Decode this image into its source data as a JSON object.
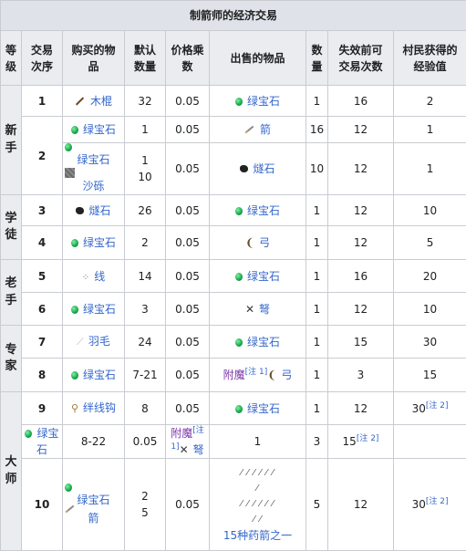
{
  "table": {
    "caption": "制箭师的经济交易",
    "headers": [
      "等级",
      "交易次序",
      "购买的物品",
      "默认数量",
      "价格乘数",
      "出售的物品",
      "数量",
      "失效前可交易次数",
      "村民获得的经验值"
    ],
    "header_lines": {
      "tier": [
        "等",
        "级"
      ],
      "order": [
        "交易",
        "次序"
      ],
      "buy": [
        "购买的物",
        "品"
      ],
      "default_qty": [
        "默认",
        "数量"
      ],
      "price_mult": [
        "价格乘",
        "数"
      ],
      "sell": "出售的物品",
      "qty": [
        "数",
        "量"
      ],
      "uses": [
        "失效前可",
        "交易次数"
      ],
      "xp": [
        "村民获得的",
        "经验值"
      ]
    },
    "tiers": {
      "novice": [
        "新",
        "手"
      ],
      "apprentice": [
        "学",
        "徒"
      ],
      "journeyman": [
        "老",
        "手"
      ],
      "expert": [
        "专",
        "家"
      ],
      "master": [
        "大",
        "师"
      ]
    },
    "note_label": "[注 1]",
    "note_label_2": "[注 2]",
    "rows": {
      "r1": {
        "order": "1",
        "buy": "木棍",
        "default_qty": "32",
        "price_mult": "0.05",
        "sell": "绿宝石",
        "qty": "1",
        "uses": "16",
        "xp": "2"
      },
      "r2a": {
        "order": "2",
        "buy": "绿宝石",
        "default_qty": "1",
        "price_mult": "0.05",
        "sell": "箭",
        "qty": "16",
        "uses": "12",
        "xp": "1"
      },
      "r2b": {
        "buy1": "绿宝石",
        "buy2": "沙砾",
        "default_qty1": "1",
        "default_qty2": "10",
        "price_mult": "0.05",
        "sell": "燧石",
        "qty": "10",
        "uses": "12",
        "xp": "1"
      },
      "r3": {
        "order": "3",
        "buy": "燧石",
        "default_qty": "26",
        "price_mult": "0.05",
        "sell": "绿宝石",
        "qty": "1",
        "uses": "12",
        "xp": "10"
      },
      "r4": {
        "order": "4",
        "buy": "绿宝石",
        "default_qty": "2",
        "price_mult": "0.05",
        "sell": "弓",
        "qty": "1",
        "uses": "12",
        "xp": "5"
      },
      "r5": {
        "order": "5",
        "buy": "线",
        "default_qty": "14",
        "price_mult": "0.05",
        "sell": "绿宝石",
        "qty": "1",
        "uses": "16",
        "xp": "20"
      },
      "r6": {
        "order": "6",
        "buy": "绿宝石",
        "default_qty": "3",
        "price_mult": "0.05",
        "sell": "弩",
        "qty": "1",
        "uses": "12",
        "xp": "10"
      },
      "r7": {
        "order": "7",
        "buy": "羽毛",
        "default_qty": "24",
        "price_mult": "0.05",
        "sell": "绿宝石",
        "qty": "1",
        "uses": "15",
        "xp": "30"
      },
      "r8": {
        "order": "8",
        "buy": "绿宝石",
        "default_qty": "7-21",
        "price_mult": "0.05",
        "sell_prefix": "附魔",
        "sell": "弓",
        "qty": "1",
        "uses": "3",
        "xp": "15"
      },
      "r9": {
        "order": "9",
        "buy": "绊线钩",
        "default_qty": "8",
        "price_mult": "0.05",
        "sell": "绿宝石",
        "qty": "1",
        "uses": "12",
        "xp": "30"
      },
      "r9b": {
        "buy": "绿宝石",
        "default_qty": "8-22",
        "price_mult": "0.05",
        "sell_prefix": "附魔",
        "sell": "弩",
        "qty": "1",
        "uses": "3",
        "xp": "15"
      },
      "r10": {
        "order": "10",
        "buy1": "绿宝石",
        "buy2": "箭",
        "default_qty1": "2",
        "default_qty2": "5",
        "price_mult": "0.05",
        "sell_icons": "⁄ ⁄ ⁄ ⁄ ⁄ ⁄",
        "sell_text": "15种药箭之一",
        "qty": "5",
        "uses": "12",
        "xp": "30"
      }
    }
  }
}
